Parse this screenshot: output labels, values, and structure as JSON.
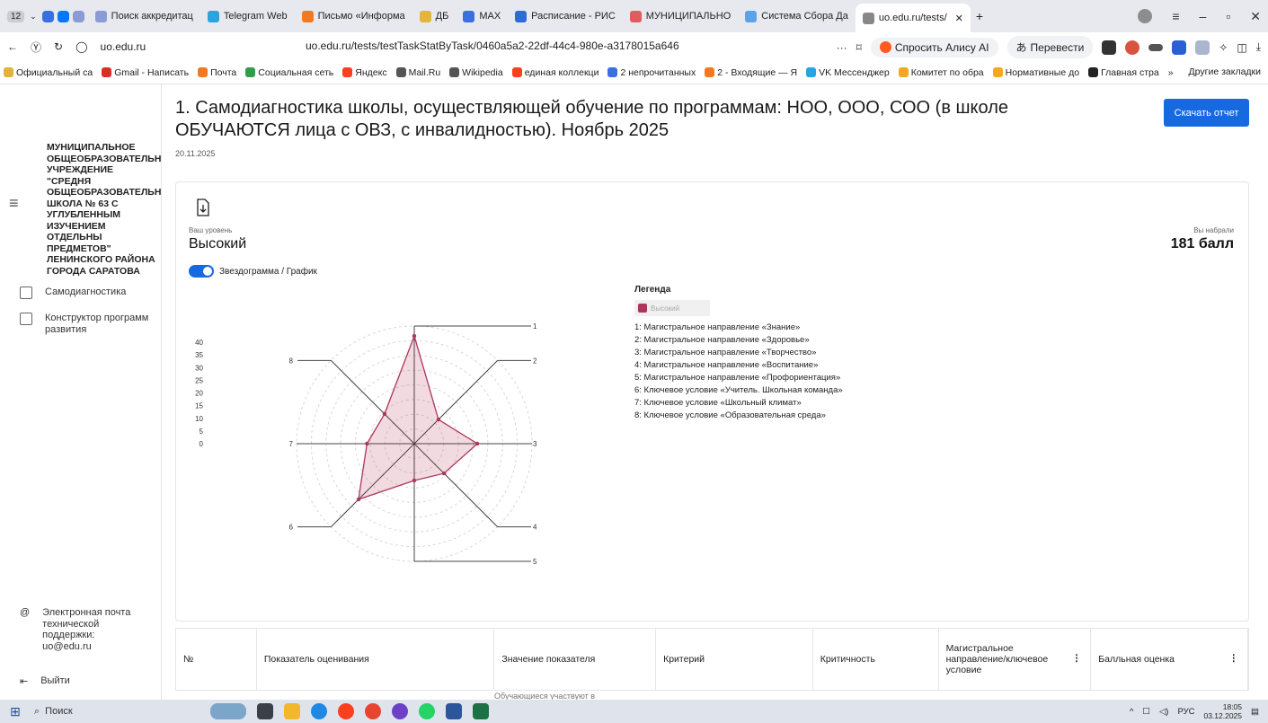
{
  "browser": {
    "tab_count": "12",
    "tabs": [
      {
        "label": "Поиск аккредитац",
        "color": "#8a9bd6"
      },
      {
        "label": "Telegram Web",
        "color": "#2aa3e0"
      },
      {
        "label": "Письмо «Информа",
        "color": "#f07a21"
      },
      {
        "label": "ДБ",
        "color": "#e3b53a"
      },
      {
        "label": "MAX",
        "color": "#3b6fe0"
      },
      {
        "label": "Расписание - РИС",
        "color": "#2d6bd6"
      },
      {
        "label": "МУНИЦИПАЛЬНО",
        "color": "#e05d5d"
      },
      {
        "label": "Система Сбора Да",
        "color": "#5aa3e8"
      },
      {
        "label": "uo.edu.ru/tests/",
        "color": "#888888"
      }
    ],
    "domain": "uo.edu.ru",
    "url": "uo.edu.ru/tests/testTaskStatByTask/0460a5a2-22df-44c4-980e-a3178015a646",
    "alice_label": "Спросить Алису AI",
    "translate_label": "Перевести",
    "bookmarks": [
      {
        "label": "Официальный са",
        "color": "#e2b23a"
      },
      {
        "label": "Gmail - Написать",
        "color": "#d93025"
      },
      {
        "label": "Почта",
        "color": "#f07a21"
      },
      {
        "label": "Социальная сеть",
        "color": "#2e9e4a"
      },
      {
        "label": "Яндекс",
        "color": "#fc3f1d"
      },
      {
        "label": "Mail.Ru",
        "color": "#555555"
      },
      {
        "label": "Wikipedia",
        "color": "#555555"
      },
      {
        "label": "единая коллекци",
        "color": "#fc3f1d"
      },
      {
        "label": "2 непрочитанных",
        "color": "#3b6fe0"
      },
      {
        "label": "2 - Входящие — Я",
        "color": "#f07a21"
      },
      {
        "label": "VK Мессенджер",
        "color": "#2aa3e0"
      },
      {
        "label": "Комитет по обра",
        "color": "#f5a623"
      },
      {
        "label": "Нормативные до",
        "color": "#f5a623"
      },
      {
        "label": "Главная стра",
        "color": "#222222"
      }
    ],
    "other_bookmarks": "Другие закладки"
  },
  "sidebar": {
    "org_name": "МУНИЦИПАЛЬНОЕ ОБЩЕОБРАЗОВАТЕЛЬН УЧРЕЖДЕНИЕ \"СРЕДНЯ ОБЩЕОБРАЗОВАТЕЛЬН ШКОЛА № 63 С УГЛУБЛЕННЫМ ИЗУЧЕНИЕМ ОТДЕЛЬНЫ ПРЕДМЕТОВ\" ЛЕНИНСКОГО РАЙОНА ГОРОДА САРАТОВА",
    "items": [
      {
        "label": "Самодиагностика"
      },
      {
        "label": "Конструктор программ развития"
      }
    ],
    "support": "Электронная почта технической поддержки: uo@edu.ru",
    "logout": "Выйти"
  },
  "main": {
    "title": "1. Самодиагностика школы, осуществляющей обучение по программам: НОО, ООО, СОО (в школе ОБУЧАЮТСЯ лица с ОВЗ, с инвалидностью). Ноябрь 2025",
    "date": "20.11.2025",
    "download_label": "Скачать отчет",
    "level_label": "Ваш уровень",
    "level_value": "Высокий",
    "score_label": "Вы набрали",
    "score_value": "181 балл",
    "toggle_label": "Звездограмма / График",
    "legend_title": "Легенда",
    "legend_series": "Высокий",
    "legend_items": [
      "1: Магистральное направление «Знание»",
      "2: Магистральное направление «Здоровье»",
      "3: Магистральное направление «Творчество»",
      "4: Магистральное направление «Воспитание»",
      "5: Магистральное направление «Профориентация»",
      "6: Ключевое условие «Учитель. Школьная команда»",
      "7: Ключевое условие «Школьный климат»",
      "8: Ключевое условие «Образовательная среда»"
    ]
  },
  "table": {
    "headers": [
      "№",
      "Показатель оценивания",
      "Значение показателя",
      "Критерий",
      "Критичность",
      "Магистральное направление/ключевое условие",
      "Балльная оценка"
    ],
    "row_peek": "Обучающиеся участвуют в"
  },
  "taskbar": {
    "search": "Поиск",
    "lang": "РУС",
    "time": "18:05",
    "date": "03.12.2025"
  },
  "colors": {
    "accent": "#1769e0",
    "series": "#b0355b"
  },
  "chart_data": {
    "type": "radar",
    "categories": [
      "1",
      "2",
      "3",
      "4",
      "5",
      "6",
      "7",
      "8"
    ],
    "series": [
      {
        "name": "Высокий",
        "values": [
          41,
          13,
          24,
          16,
          14,
          30,
          18,
          16
        ]
      }
    ],
    "ylim": [
      0,
      40
    ],
    "yticks": [
      0,
      5,
      10,
      15,
      20,
      25,
      30,
      35,
      40
    ]
  }
}
